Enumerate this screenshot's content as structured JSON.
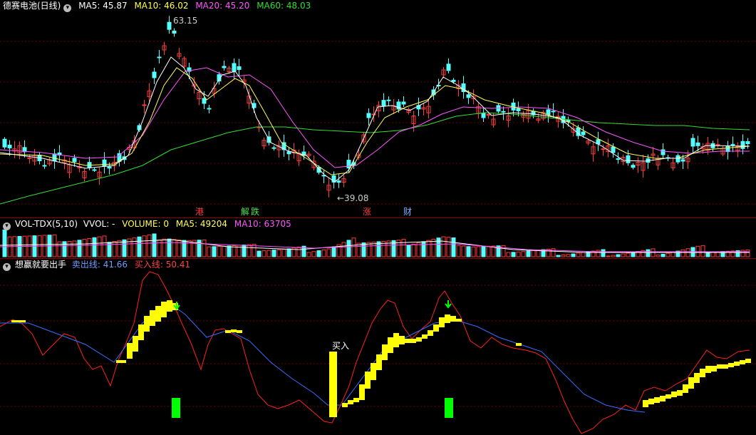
{
  "header": {
    "stock": "德赛电池(日线)",
    "ma5": "MA5: 45.87",
    "ma10": "MA10: 46.02",
    "ma20": "MA20: 45.20",
    "ma60": "MA60: 48.03"
  },
  "price_annotations": {
    "high": "63.15",
    "low": "←39.08"
  },
  "event_tags": [
    {
      "text": "港",
      "color": "#ff3b3b"
    },
    {
      "text": "解",
      "color": "#4fe04f"
    },
    {
      "text": "跌",
      "color": "#4fe04f"
    },
    {
      "text": "涨",
      "color": "#ff3b3b"
    },
    {
      "text": "财",
      "color": "#7fb0ff"
    }
  ],
  "vol_header": {
    "name": "VOL-TDX(5,10)",
    "vvol": "VVOL: -",
    "volume": "VOLUME: 0",
    "ma5": "MA5: 49204",
    "ma10": "MA10: 63705"
  },
  "ind_header": {
    "name": "想赢就要出手",
    "sell": "卖出线: 41.66",
    "buy": "买入线: 50.41"
  },
  "buy_label": "买入",
  "colors": {
    "up": "#ff3b3b",
    "down": "#54ffff",
    "ma5": "#ffffff",
    "ma10": "#ffff55",
    "ma20": "#ff55ff",
    "ma60": "#33dd33",
    "sell_line": "#3a6cff",
    "buy_line": "#ff2020",
    "signal": "#ffff00",
    "green_bar": "#00ff00"
  },
  "icons": [
    "collapse-circle-icon",
    "arrow-down-icon"
  ]
}
